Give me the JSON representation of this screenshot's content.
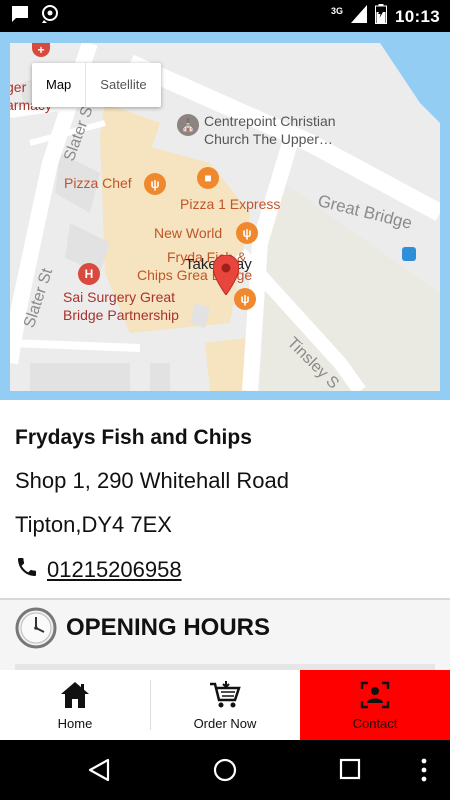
{
  "status_bar": {
    "network_type": "3G",
    "time": "10:13",
    "icons": [
      "message-icon",
      "sync-icon",
      "signal-icon",
      "battery-icon"
    ]
  },
  "map": {
    "toggle": {
      "map_label": "Map",
      "satellite_label": "Satellite",
      "selected": "Map"
    },
    "labels": {
      "pharmacy_line1": "ger",
      "pharmacy_line2": "armacy",
      "church_line1": "Centrepoint Christian",
      "church_line2": "Church The Upper…",
      "pizza_chef": "Pizza Chef",
      "pizza_express": "Pizza 1 Express",
      "new_world": "New World",
      "frydays_line1": "Fryda   Fish &",
      "frydays_line2": "Chips Grea  Bridge",
      "takeaway": "Takeaway",
      "surgery_line1": "Sai Surgery Great",
      "surgery_line2": "Bridge Partnership",
      "slater_st_1": "Slater St",
      "slater_st_2": "Slater St",
      "great_bridge": "Great Bridge",
      "tinsley": "Tinsley S"
    },
    "colors": {
      "water": "#94cdf4",
      "road": "#ffffff",
      "building": "#f6e3bf",
      "pin": "#e8453c"
    }
  },
  "info": {
    "business_name": "Frydays Fish and Chips",
    "address_line1": "Shop 1, 290 Whitehall Road",
    "address_line2": "Tipton,DY4 7EX",
    "phone": "01215206958"
  },
  "hours": {
    "title": "OPENING HOURS"
  },
  "bottom_nav": {
    "items": [
      {
        "label": "Home",
        "icon": "home-icon",
        "active": false
      },
      {
        "label": "Order Now",
        "icon": "cart-icon",
        "active": false
      },
      {
        "label": "Contact",
        "icon": "contact-icon",
        "active": true
      }
    ],
    "active_color": "#ff0000"
  },
  "system_nav": {
    "icons": [
      "back-icon",
      "home-circle-icon",
      "recents-icon",
      "more-icon"
    ]
  }
}
